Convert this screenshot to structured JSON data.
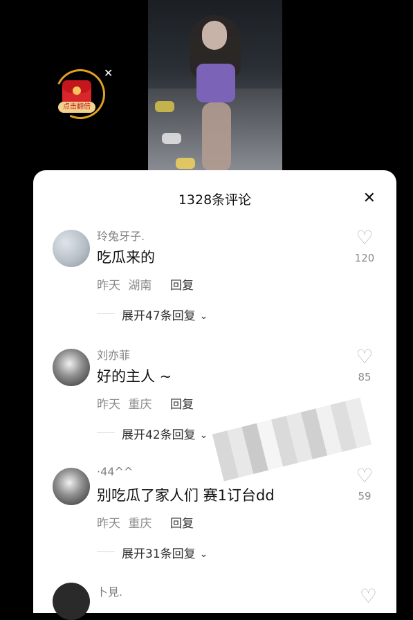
{
  "red_packet": {
    "label": "点击翻倍",
    "close_icon": "close-icon"
  },
  "comments_sheet": {
    "title": "1328条评论",
    "close_icon": "close-icon",
    "comments": [
      {
        "username": "玲兔牙子.",
        "text": "吃瓜来的",
        "time": "昨天",
        "location": "湖南",
        "reply_label": "回复",
        "expand_label": "展开47条回复",
        "likes": "120"
      },
      {
        "username": "刘亦菲",
        "text": "好的主人 ~",
        "time": "昨天",
        "location": "重庆",
        "reply_label": "回复",
        "expand_label": "展开42条回复",
        "likes": "85"
      },
      {
        "username": "·44^^",
        "text": "别吃瓜了家人们 赛1订台dd",
        "time": "昨天",
        "location": "重庆",
        "reply_label": "回复",
        "expand_label": "展开31条回复",
        "likes": "59"
      }
    ],
    "next_partial_username": "卜見."
  }
}
